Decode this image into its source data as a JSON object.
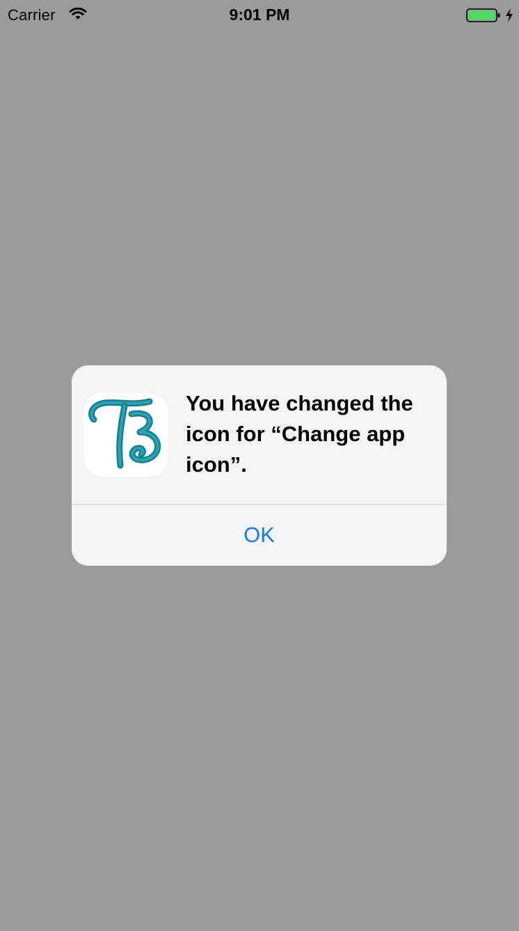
{
  "status_bar": {
    "carrier": "Carrier",
    "time": "9:01 PM",
    "icons": [
      "wifi-icon",
      "battery-icon",
      "charging-bolt-icon"
    ],
    "battery_color": "#4cd964"
  },
  "background_color": "#9b9b9b",
  "alert": {
    "app_icon": "app-icon-tb-monogram",
    "icon_color": "#1a8fa3",
    "message": "You have changed the icon for “Change app icon”.",
    "ok_label": "OK",
    "ok_color": "#0f7af5"
  }
}
